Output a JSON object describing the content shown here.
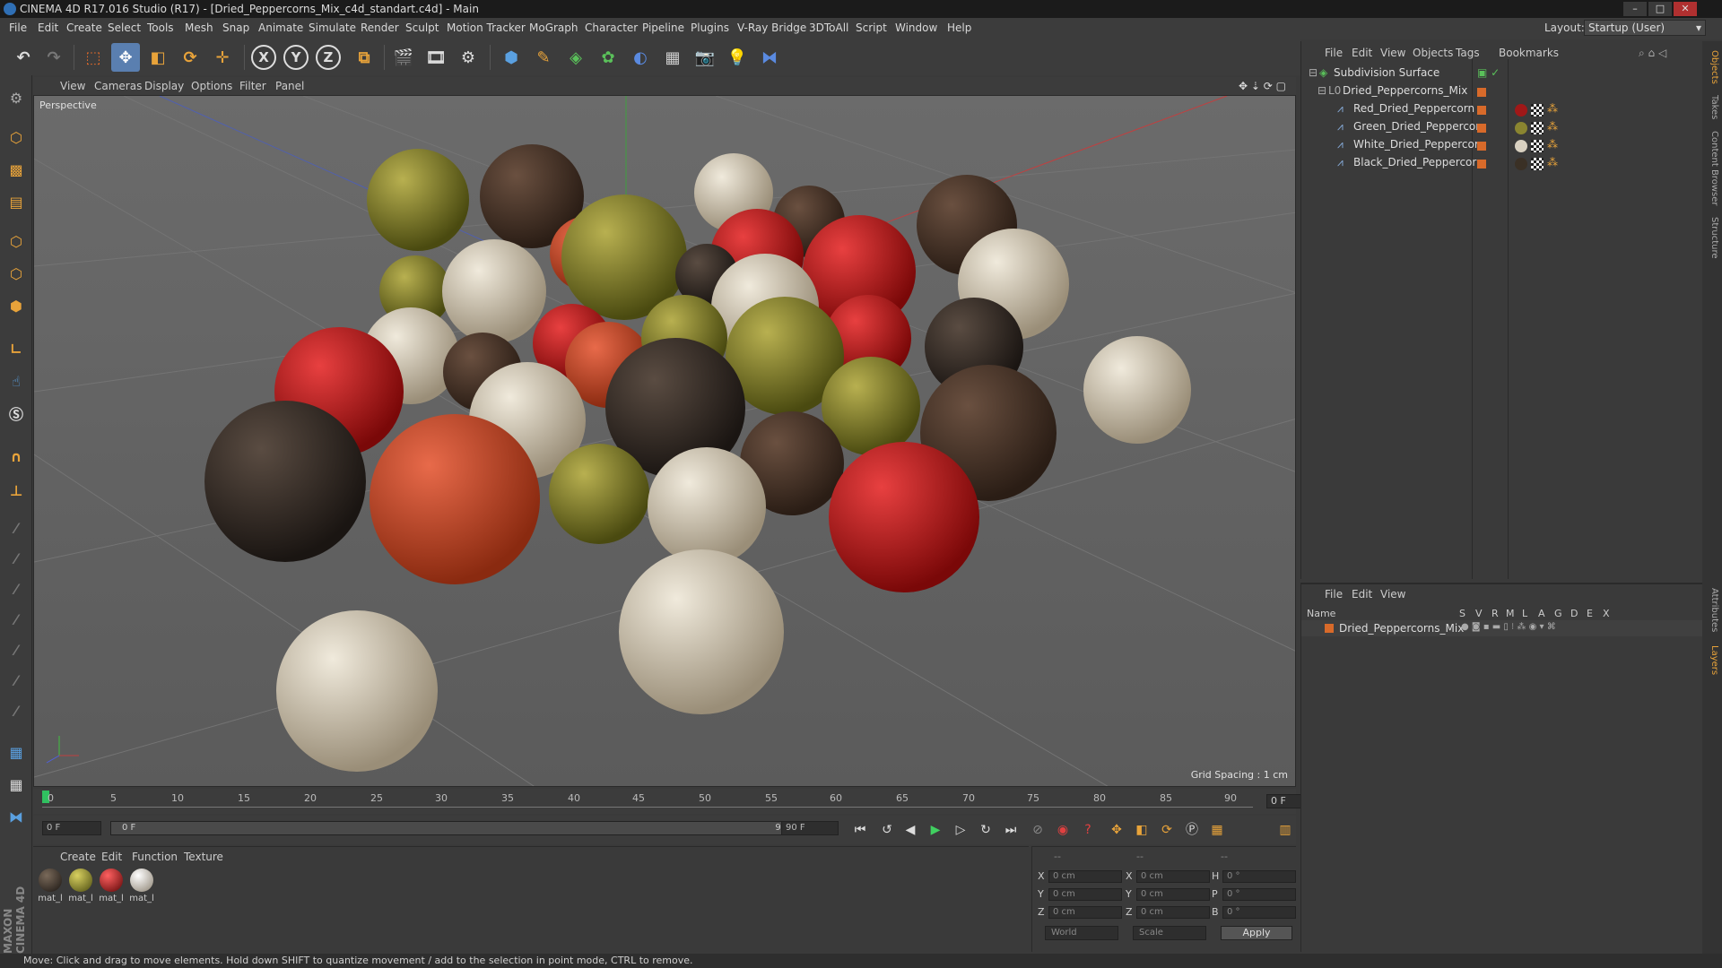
{
  "window": {
    "title": "CINEMA 4D R17.016 Studio (R17) - [Dried_Peppercorns_Mix_c4d_standart.c4d] - Main"
  },
  "menubar": {
    "items": [
      "File",
      "Edit",
      "Create",
      "Select",
      "Tools",
      "Mesh",
      "Snap",
      "Animate",
      "Simulate",
      "Render",
      "Sculpt",
      "Motion Tracker",
      "MoGraph",
      "Character",
      "Pipeline",
      "Plugins",
      "V-Ray Bridge",
      "3DToAll",
      "Script",
      "Window",
      "Help"
    ],
    "layout_label": "Layout:",
    "layout_value": "Startup (User)"
  },
  "toolbar": {
    "axis_labels": [
      "X",
      "Y",
      "Z"
    ]
  },
  "viewport": {
    "menu": [
      "View",
      "Cameras",
      "Display",
      "Options",
      "Filter",
      "Panel"
    ],
    "label": "Perspective",
    "grid_spacing": "Grid Spacing : 1 cm"
  },
  "timeline": {
    "ticks": [
      "0",
      "5",
      "10",
      "15",
      "20",
      "25",
      "30",
      "35",
      "40",
      "45",
      "50",
      "55",
      "60",
      "65",
      "70",
      "75",
      "80",
      "85",
      "90"
    ],
    "current_frame": "0 F",
    "start_field": "0 F",
    "range_start": "0 F",
    "range_end": "90 F",
    "end_field": "90 F"
  },
  "material_manager": {
    "menu": [
      "Create",
      "Edit",
      "Function",
      "Texture"
    ],
    "materials": [
      {
        "name": "mat_l",
        "color": "#3a3025"
      },
      {
        "name": "mat_l",
        "color": "#8a8530"
      },
      {
        "name": "mat_l",
        "color": "#a01818"
      },
      {
        "name": "mat_l",
        "color": "#d8d0c0"
      }
    ]
  },
  "coordinates": {
    "header": [
      "--",
      "--",
      "--"
    ],
    "rows": [
      {
        "a": "X",
        "av": "0 cm",
        "b": "X",
        "bv": "0 cm",
        "c": "H",
        "cv": "0 °"
      },
      {
        "a": "Y",
        "av": "0 cm",
        "b": "Y",
        "bv": "0 cm",
        "c": "P",
        "cv": "0 °"
      },
      {
        "a": "Z",
        "av": "0 cm",
        "b": "Z",
        "bv": "0 cm",
        "c": "B",
        "cv": "0 °"
      }
    ],
    "mode": "World",
    "scale": "Scale",
    "apply": "Apply"
  },
  "object_manager": {
    "menu": [
      "File",
      "Edit",
      "View",
      "Objects",
      "Tags",
      "Bookmarks"
    ],
    "objects": [
      {
        "name": "Subdivision Surface"
      },
      {
        "name": "Dried_Peppercorns_Mix"
      },
      {
        "name": "Red_Dried_Peppercorn",
        "tag_color": "#a01818"
      },
      {
        "name": "Green_Dried_Peppercorn",
        "tag_color": "#8a8530"
      },
      {
        "name": "White_Dried_Peppercorn",
        "tag_color": "#d8d0c0"
      },
      {
        "name": "Black_Dried_Peppercorn",
        "tag_color": "#3a3025"
      }
    ]
  },
  "layer_manager": {
    "menu": [
      "File",
      "Edit",
      "View"
    ],
    "columns": [
      "Name",
      "S",
      "V",
      "R",
      "M",
      "L",
      "A",
      "G",
      "D",
      "E",
      "X"
    ],
    "layers": [
      {
        "name": "Dried_Peppercorns_Mix"
      }
    ]
  },
  "right_tabs": [
    "Objects",
    "Takes",
    "Content Browser",
    "Structure",
    "Attributes",
    "Layers"
  ],
  "status": "Move: Click and drag to move elements. Hold down SHIFT to quantize movement / add to the selection in point mode, CTRL to remove.",
  "brand": "MAXON CINEMA 4D"
}
